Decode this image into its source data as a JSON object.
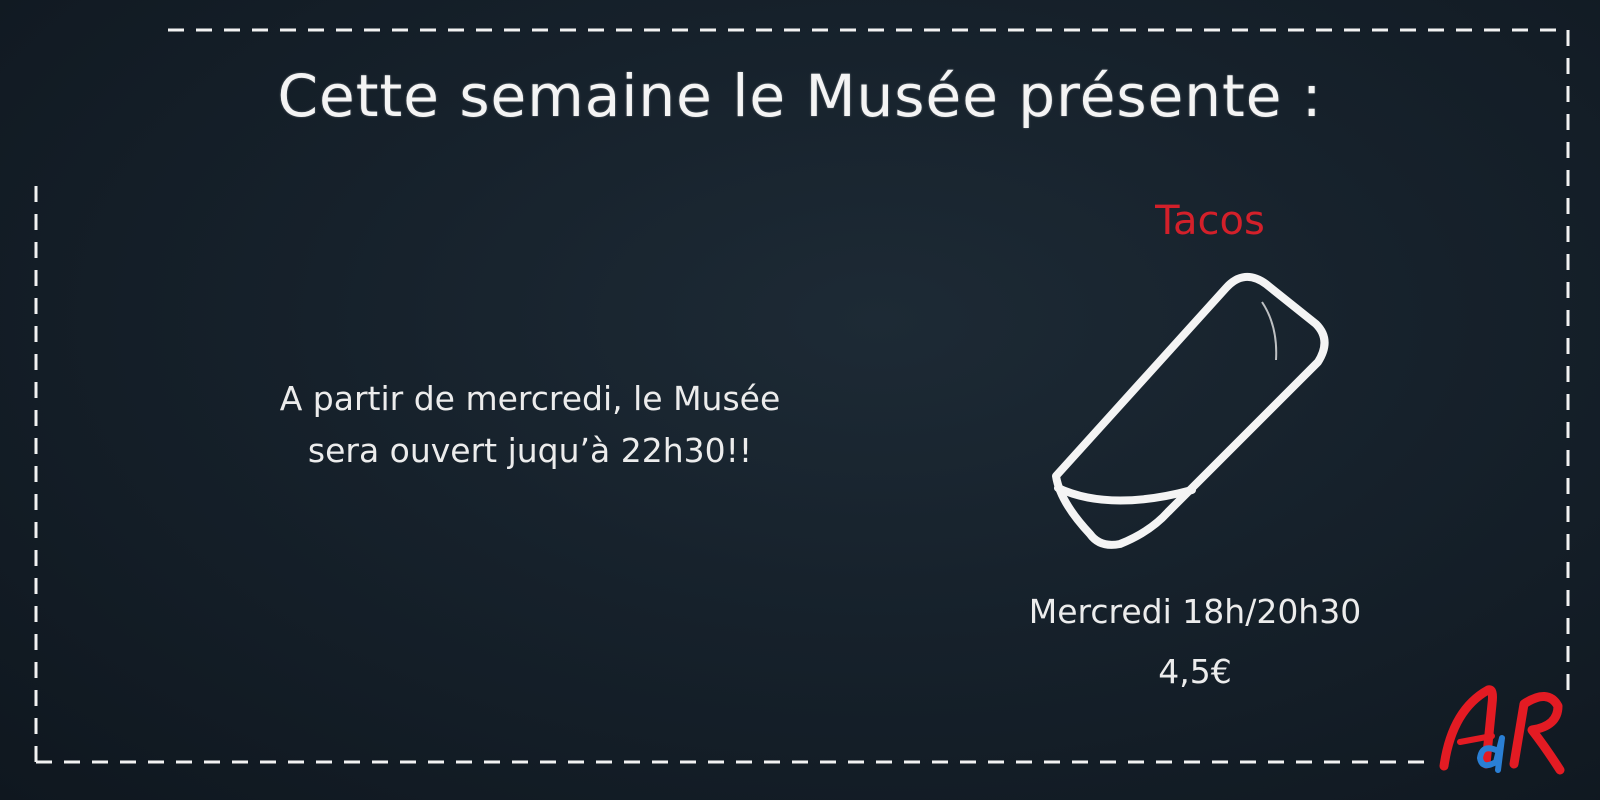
{
  "header": {
    "title": "Cette semaine le Musée présente :"
  },
  "notice": {
    "line1": "A partir de mercredi, le Musée",
    "line2": "sera ouvert juqu’à 22h30!!"
  },
  "special": {
    "name": "Tacos",
    "icon": "tacos-icon",
    "schedule": "Mercredi 18h/20h30",
    "price": "4,5€"
  },
  "logo": {
    "text": "AdR",
    "colors": {
      "red": "#e31b23",
      "blue": "#2a7fd4"
    }
  },
  "colors": {
    "background": "#16212b",
    "chalk": "#f2f2f2",
    "accent": "#d3202a"
  }
}
